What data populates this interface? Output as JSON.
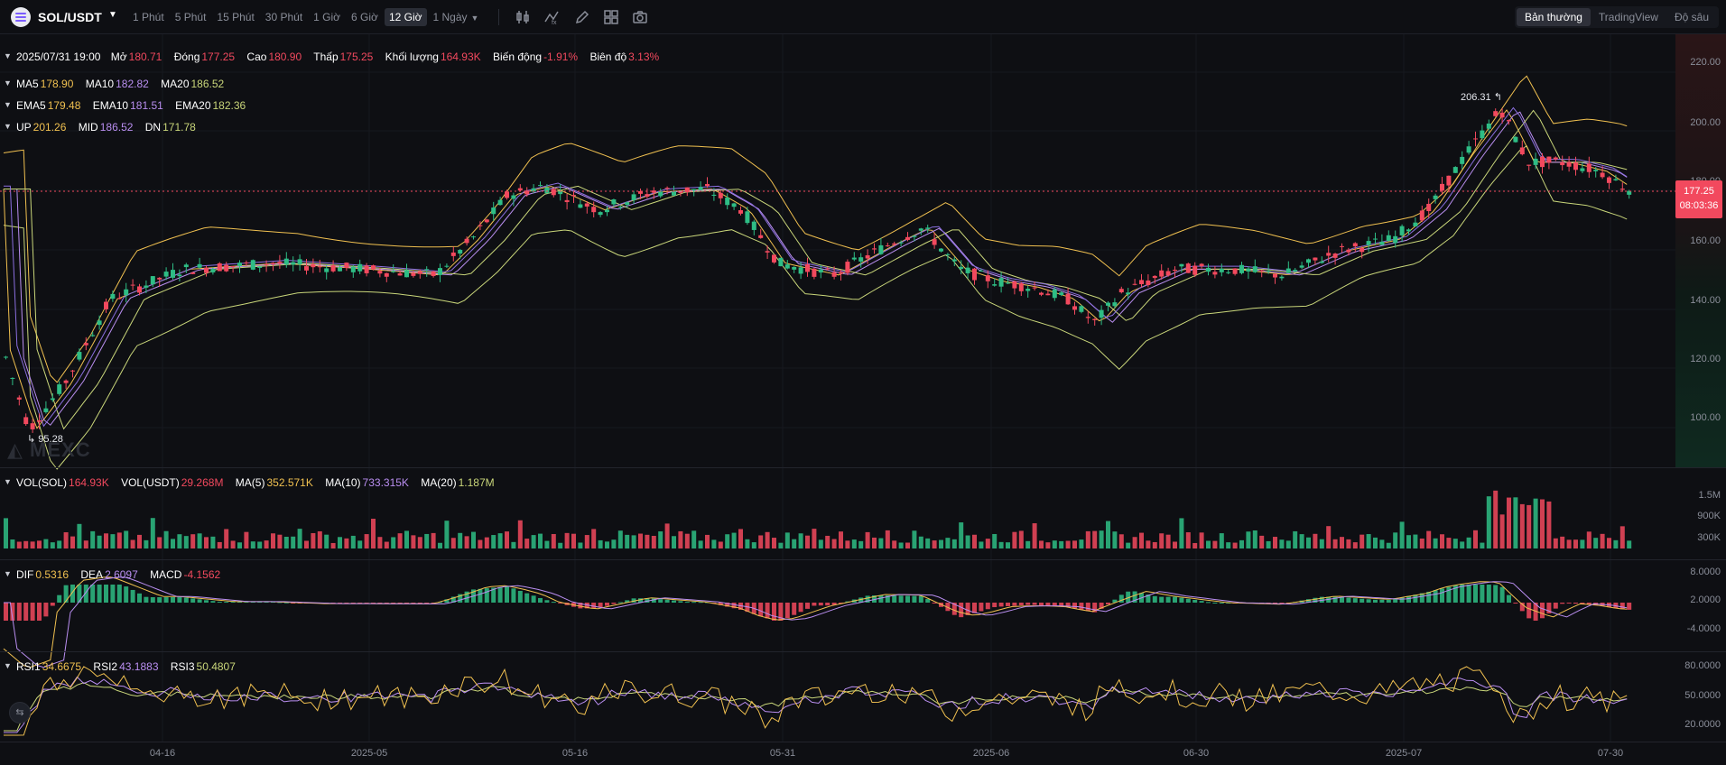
{
  "header": {
    "symbol": "SOL/USDT",
    "intervals": [
      "1 Phút",
      "5 Phút",
      "15 Phút",
      "30 Phút",
      "1 Giờ",
      "6 Giờ",
      "12 Giờ",
      "1 Ngày"
    ],
    "active_interval": "12 Giờ",
    "view_modes": [
      "Bản thường",
      "TradingView",
      "Độ sâu"
    ],
    "active_view": "Bản thường",
    "tools": [
      "candle-style-icon",
      "indicator-icon",
      "draw-icon",
      "layout-icon",
      "camera-icon"
    ]
  },
  "ohlc": {
    "date": "2025/07/31 19:00",
    "open_label": "Mở",
    "open": "180.71",
    "close_label": "Đóng",
    "close": "177.25",
    "high_label": "Cao",
    "high": "180.90",
    "low_label": "Thấp",
    "low": "175.25",
    "volume_label": "Khối lượng",
    "volume": "164.93K",
    "change_label": "Biến động",
    "change": "-1.91%",
    "amplitude_label": "Biên độ",
    "amplitude": "3.13%"
  },
  "ma": {
    "ma5_label": "MA5",
    "ma5": "178.90",
    "ma10_label": "MA10",
    "ma10": "182.82",
    "ma20_label": "MA20",
    "ma20": "186.52"
  },
  "ema": {
    "ema5_label": "EMA5",
    "ema5": "179.48",
    "ema10_label": "EMA10",
    "ema10": "181.51",
    "ema20_label": "EMA20",
    "ema20": "182.36"
  },
  "boll": {
    "up_label": "UP",
    "up": "201.26",
    "mid_label": "MID",
    "mid": "186.52",
    "dn_label": "DN",
    "dn": "171.78"
  },
  "price_axis": [
    "220.00",
    "200.00",
    "180.00",
    "160.00",
    "140.00",
    "120.00",
    "100.00"
  ],
  "last_price": "177.25",
  "countdown": "08:03:36",
  "high_marker": "206.31",
  "low_marker": "95.28",
  "watermark": "MEXC",
  "vol": {
    "vol_sol_label": "VOL(SOL)",
    "vol_sol": "164.93K",
    "vol_usdt_label": "VOL(USDT)",
    "vol_usdt": "29.268M",
    "ma5_label": "MA(5)",
    "ma5": "352.571K",
    "ma10_label": "MA(10)",
    "ma10": "733.315K",
    "ma20_label": "MA(20)",
    "ma20": "1.187M",
    "axis": [
      "1.5M",
      "900K",
      "300K"
    ]
  },
  "macd": {
    "dif_label": "DIF",
    "dif": "0.5316",
    "dea_label": "DEA",
    "dea": "2.6097",
    "macd_label": "MACD",
    "macd": "-4.1562",
    "axis": [
      "8.0000",
      "2.0000",
      "-4.0000"
    ]
  },
  "rsi": {
    "rsi1_label": "RSI1",
    "rsi1": "34.6675",
    "rsi2_label": "RSI2",
    "rsi2": "43.1883",
    "rsi3_label": "RSI3",
    "rsi3": "50.4807",
    "axis": [
      "80.0000",
      "50.0000",
      "20.0000"
    ]
  },
  "time_axis": [
    "04-16",
    "2025-05",
    "05-16",
    "05-31",
    "2025-06",
    "06-30",
    "2025-07",
    "07-30"
  ],
  "colors": {
    "up": "#2ebd85",
    "down": "#f2495e",
    "ma5": "#f0c050",
    "ma10": "#b98ef0",
    "ma20": "#c9d67a",
    "bg": "#0e0f13"
  }
}
